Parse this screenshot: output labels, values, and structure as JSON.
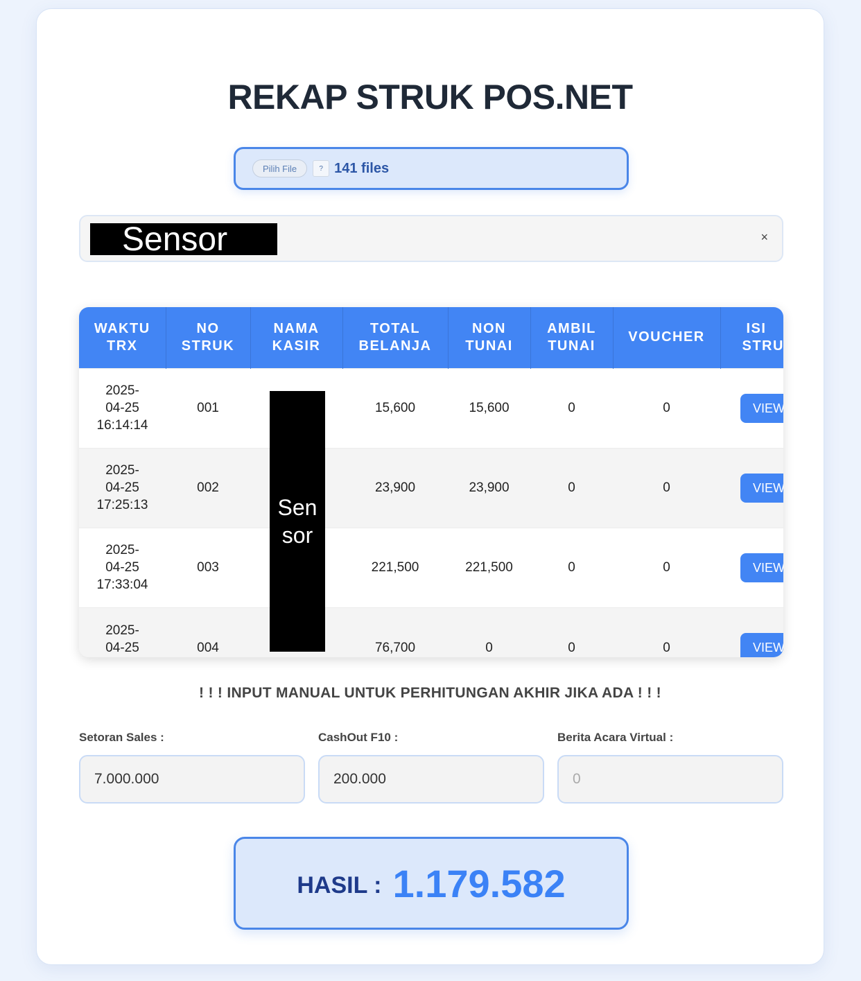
{
  "title": "REKAP STRUK POS.NET",
  "file_picker": {
    "button_label": "Pilih File",
    "icon": "?",
    "count_label": "141 files"
  },
  "search": {
    "redaction": "Sensor",
    "clear": "×"
  },
  "table": {
    "headers": [
      "WAKTU TRX",
      "NO STRUK",
      "NAMA KASIR",
      "TOTAL BELANJA",
      "NON TUNAI",
      "AMBIL TUNAI",
      "VOUCHER",
      "ISI STRUK"
    ],
    "header_lines": [
      [
        "WAKTU",
        "TRX"
      ],
      [
        "NO",
        "STRUK"
      ],
      [
        "NAMA",
        "KASIR"
      ],
      [
        "TOTAL",
        "BELANJA"
      ],
      [
        "NON",
        "TUNAI"
      ],
      [
        "AMBIL",
        "TUNAI"
      ],
      [
        "VOUCHER",
        ""
      ],
      [
        "ISI",
        "STRU"
      ]
    ],
    "rows": [
      {
        "date": "2025-",
        "date2": "04-25",
        "time": "16:14:14",
        "no": "001",
        "total": "15,600",
        "non_tunai": "15,600",
        "ambil_tunai": "0",
        "voucher": "0",
        "action": "VIEW"
      },
      {
        "date": "2025-",
        "date2": "04-25",
        "time": "17:25:13",
        "no": "002",
        "total": "23,900",
        "non_tunai": "23,900",
        "ambil_tunai": "0",
        "voucher": "0",
        "action": "VIEW"
      },
      {
        "date": "2025-",
        "date2": "04-25",
        "time": "17:33:04",
        "no": "003",
        "total": "221,500",
        "non_tunai": "221,500",
        "ambil_tunai": "0",
        "voucher": "0",
        "action": "VIEW"
      },
      {
        "date": "2025-",
        "date2": "04-25",
        "time": "",
        "no": "004",
        "total": "76,700",
        "non_tunai": "0",
        "ambil_tunai": "0",
        "voucher": "0",
        "action": "VIEW"
      }
    ],
    "kasir_redaction": "Sen sor"
  },
  "notice": "! ! ! INPUT MANUAL UNTUK PERHITUNGAN AKHIR JIKA ADA ! ! !",
  "fields": {
    "setoran_label": "Setoran Sales :",
    "setoran_value": "7.000.000",
    "cashout_label": "CashOut F10 :",
    "cashout_value": "200.000",
    "berita_label": "Berita Acara Virtual :",
    "berita_placeholder": "0"
  },
  "result": {
    "label": "HASIL :",
    "value": "1.179.582"
  },
  "colors": {
    "accent": "#4285f4",
    "result_value": "#3b82f6",
    "title": "#1f2937"
  }
}
